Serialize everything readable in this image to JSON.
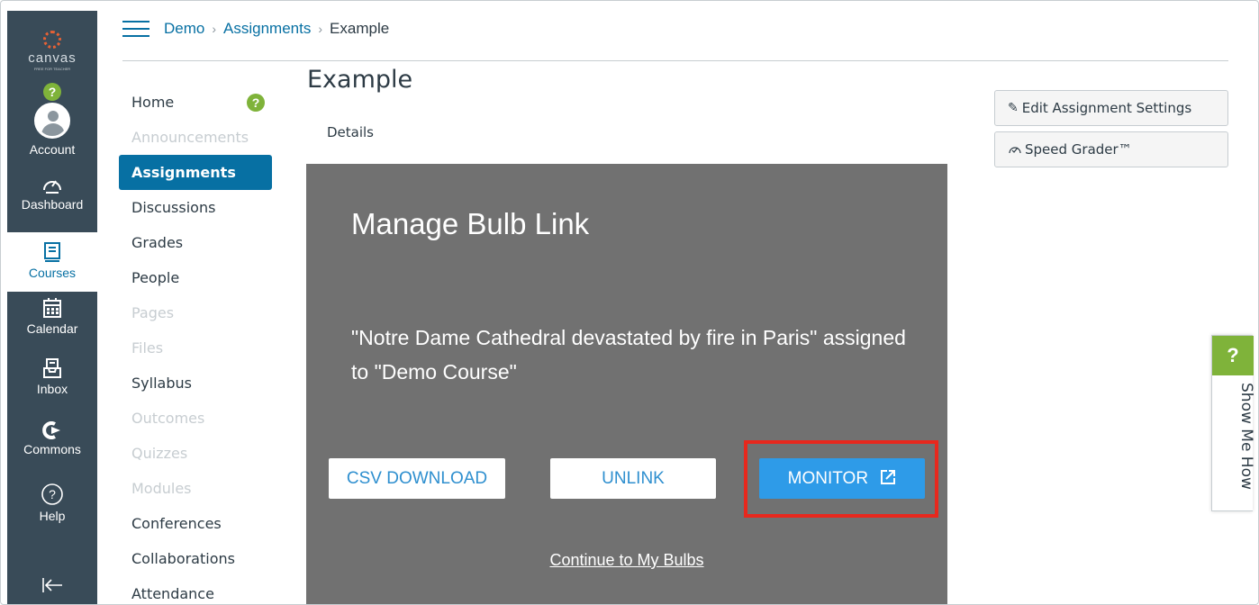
{
  "global_nav": {
    "logo_text": "canvas",
    "logo_tagline": "FREE FOR TEACHER",
    "items": [
      {
        "label": "Account",
        "icon": "account-avatar-icon"
      },
      {
        "label": "Dashboard",
        "icon": "dashboard-gauge-icon"
      },
      {
        "label": "Courses",
        "icon": "courses-book-icon",
        "active": true
      },
      {
        "label": "Calendar",
        "icon": "calendar-icon"
      },
      {
        "label": "Inbox",
        "icon": "inbox-icon"
      },
      {
        "label": "Commons",
        "icon": "commons-icon"
      },
      {
        "label": "Help",
        "icon": "help-icon"
      }
    ],
    "account_badge": "?",
    "collapse_icon": "collapse-arrow-icon"
  },
  "breadcrumb": {
    "course": "Demo",
    "section": "Assignments",
    "current": "Example",
    "separator": "›"
  },
  "course_nav": {
    "help_badge": "?",
    "items": [
      {
        "label": "Home",
        "state": "normal"
      },
      {
        "label": "Announcements",
        "state": "disabled"
      },
      {
        "label": "Assignments",
        "state": "active"
      },
      {
        "label": "Discussions",
        "state": "normal"
      },
      {
        "label": "Grades",
        "state": "normal"
      },
      {
        "label": "People",
        "state": "normal"
      },
      {
        "label": "Pages",
        "state": "disabled"
      },
      {
        "label": "Files",
        "state": "disabled"
      },
      {
        "label": "Syllabus",
        "state": "normal"
      },
      {
        "label": "Outcomes",
        "state": "disabled"
      },
      {
        "label": "Quizzes",
        "state": "disabled"
      },
      {
        "label": "Modules",
        "state": "disabled"
      },
      {
        "label": "Conferences",
        "state": "normal"
      },
      {
        "label": "Collaborations",
        "state": "normal"
      },
      {
        "label": "Attendance",
        "state": "normal"
      }
    ]
  },
  "main": {
    "title": "Example",
    "details_label": "Details",
    "bulb": {
      "title": "Manage Bulb Link",
      "message": "\"Notre Dame Cathedral devastated by fire in Paris\" assigned to \"Demo Course\"",
      "csv_label": "CSV DOWNLOAD",
      "unlink_label": "UNLINK",
      "monitor_label": "MONITOR",
      "continue_label": "Continue to My Bulbs"
    }
  },
  "sidebar_right": {
    "edit_label": "Edit Assignment Settings",
    "speedgrader_label": "Speed Grader™"
  },
  "show_me_how": {
    "badge": "?",
    "label": "Show Me How"
  },
  "colors": {
    "nav_bg": "#394b58",
    "link": "#0770a3",
    "bulb_bg": "#717171",
    "monitor_blue": "#2e9be8",
    "highlight_red": "#e8281d",
    "help_green": "#7fb33a"
  }
}
